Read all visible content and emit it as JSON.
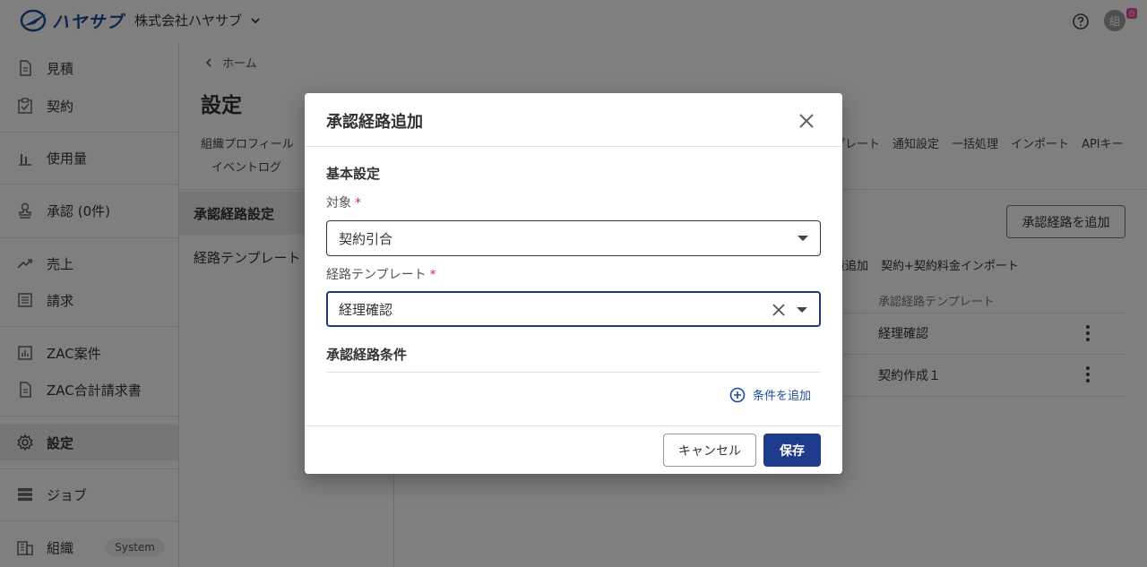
{
  "header": {
    "logo_text": "ハヤサブ",
    "org_name": "株式会社ハヤサブ",
    "avatar_initial": "組",
    "avatar_badge": "白"
  },
  "sidebar": {
    "items": [
      {
        "label": "見積",
        "icon": "document-icon"
      },
      {
        "label": "契約",
        "icon": "clipboard-check-icon"
      },
      {
        "label": "使用量",
        "icon": "bar-chart-icon"
      },
      {
        "label": "承認 (0件)",
        "icon": "stamp-icon"
      },
      {
        "label": "売上",
        "icon": "trend-up-icon"
      },
      {
        "label": "請求",
        "icon": "list-document-icon"
      },
      {
        "label": "ZAC案件",
        "icon": "chart-box-icon"
      },
      {
        "label": "ZAC合計請求書",
        "icon": "document-icon"
      },
      {
        "label": "設定",
        "icon": "gear-icon"
      },
      {
        "label": "ジョブ",
        "icon": "stack-icon"
      },
      {
        "label": "組織",
        "icon": "building-icon",
        "badge": "System"
      }
    ]
  },
  "main": {
    "breadcrumb": "ホーム",
    "title": "設定",
    "tabs_left": "組織プロフィール",
    "tabs_right": [
      "プレート",
      "通知設定",
      "一括処理",
      "インポート",
      "APIキー"
    ],
    "tabs_row2": "イベントログ",
    "subnav": [
      "承認経路設定",
      "経路テンプレート"
    ],
    "add_route_button": "承認経路を追加",
    "action_links": [
      "量追加",
      "契約+契約料金インポート"
    ],
    "column_header": "承認経路テンプレート",
    "rows": [
      "経理確認",
      "契約作成１"
    ]
  },
  "modal": {
    "title": "承認経路追加",
    "section_basic": "基本設定",
    "target_label": "対象",
    "target_value": "契約引合",
    "template_label": "経路テンプレート",
    "template_value": "経理確認",
    "required_mark": "*",
    "section_conditions": "承認経路条件",
    "add_condition": "条件を追加",
    "cancel": "キャンセル",
    "save": "保存"
  }
}
